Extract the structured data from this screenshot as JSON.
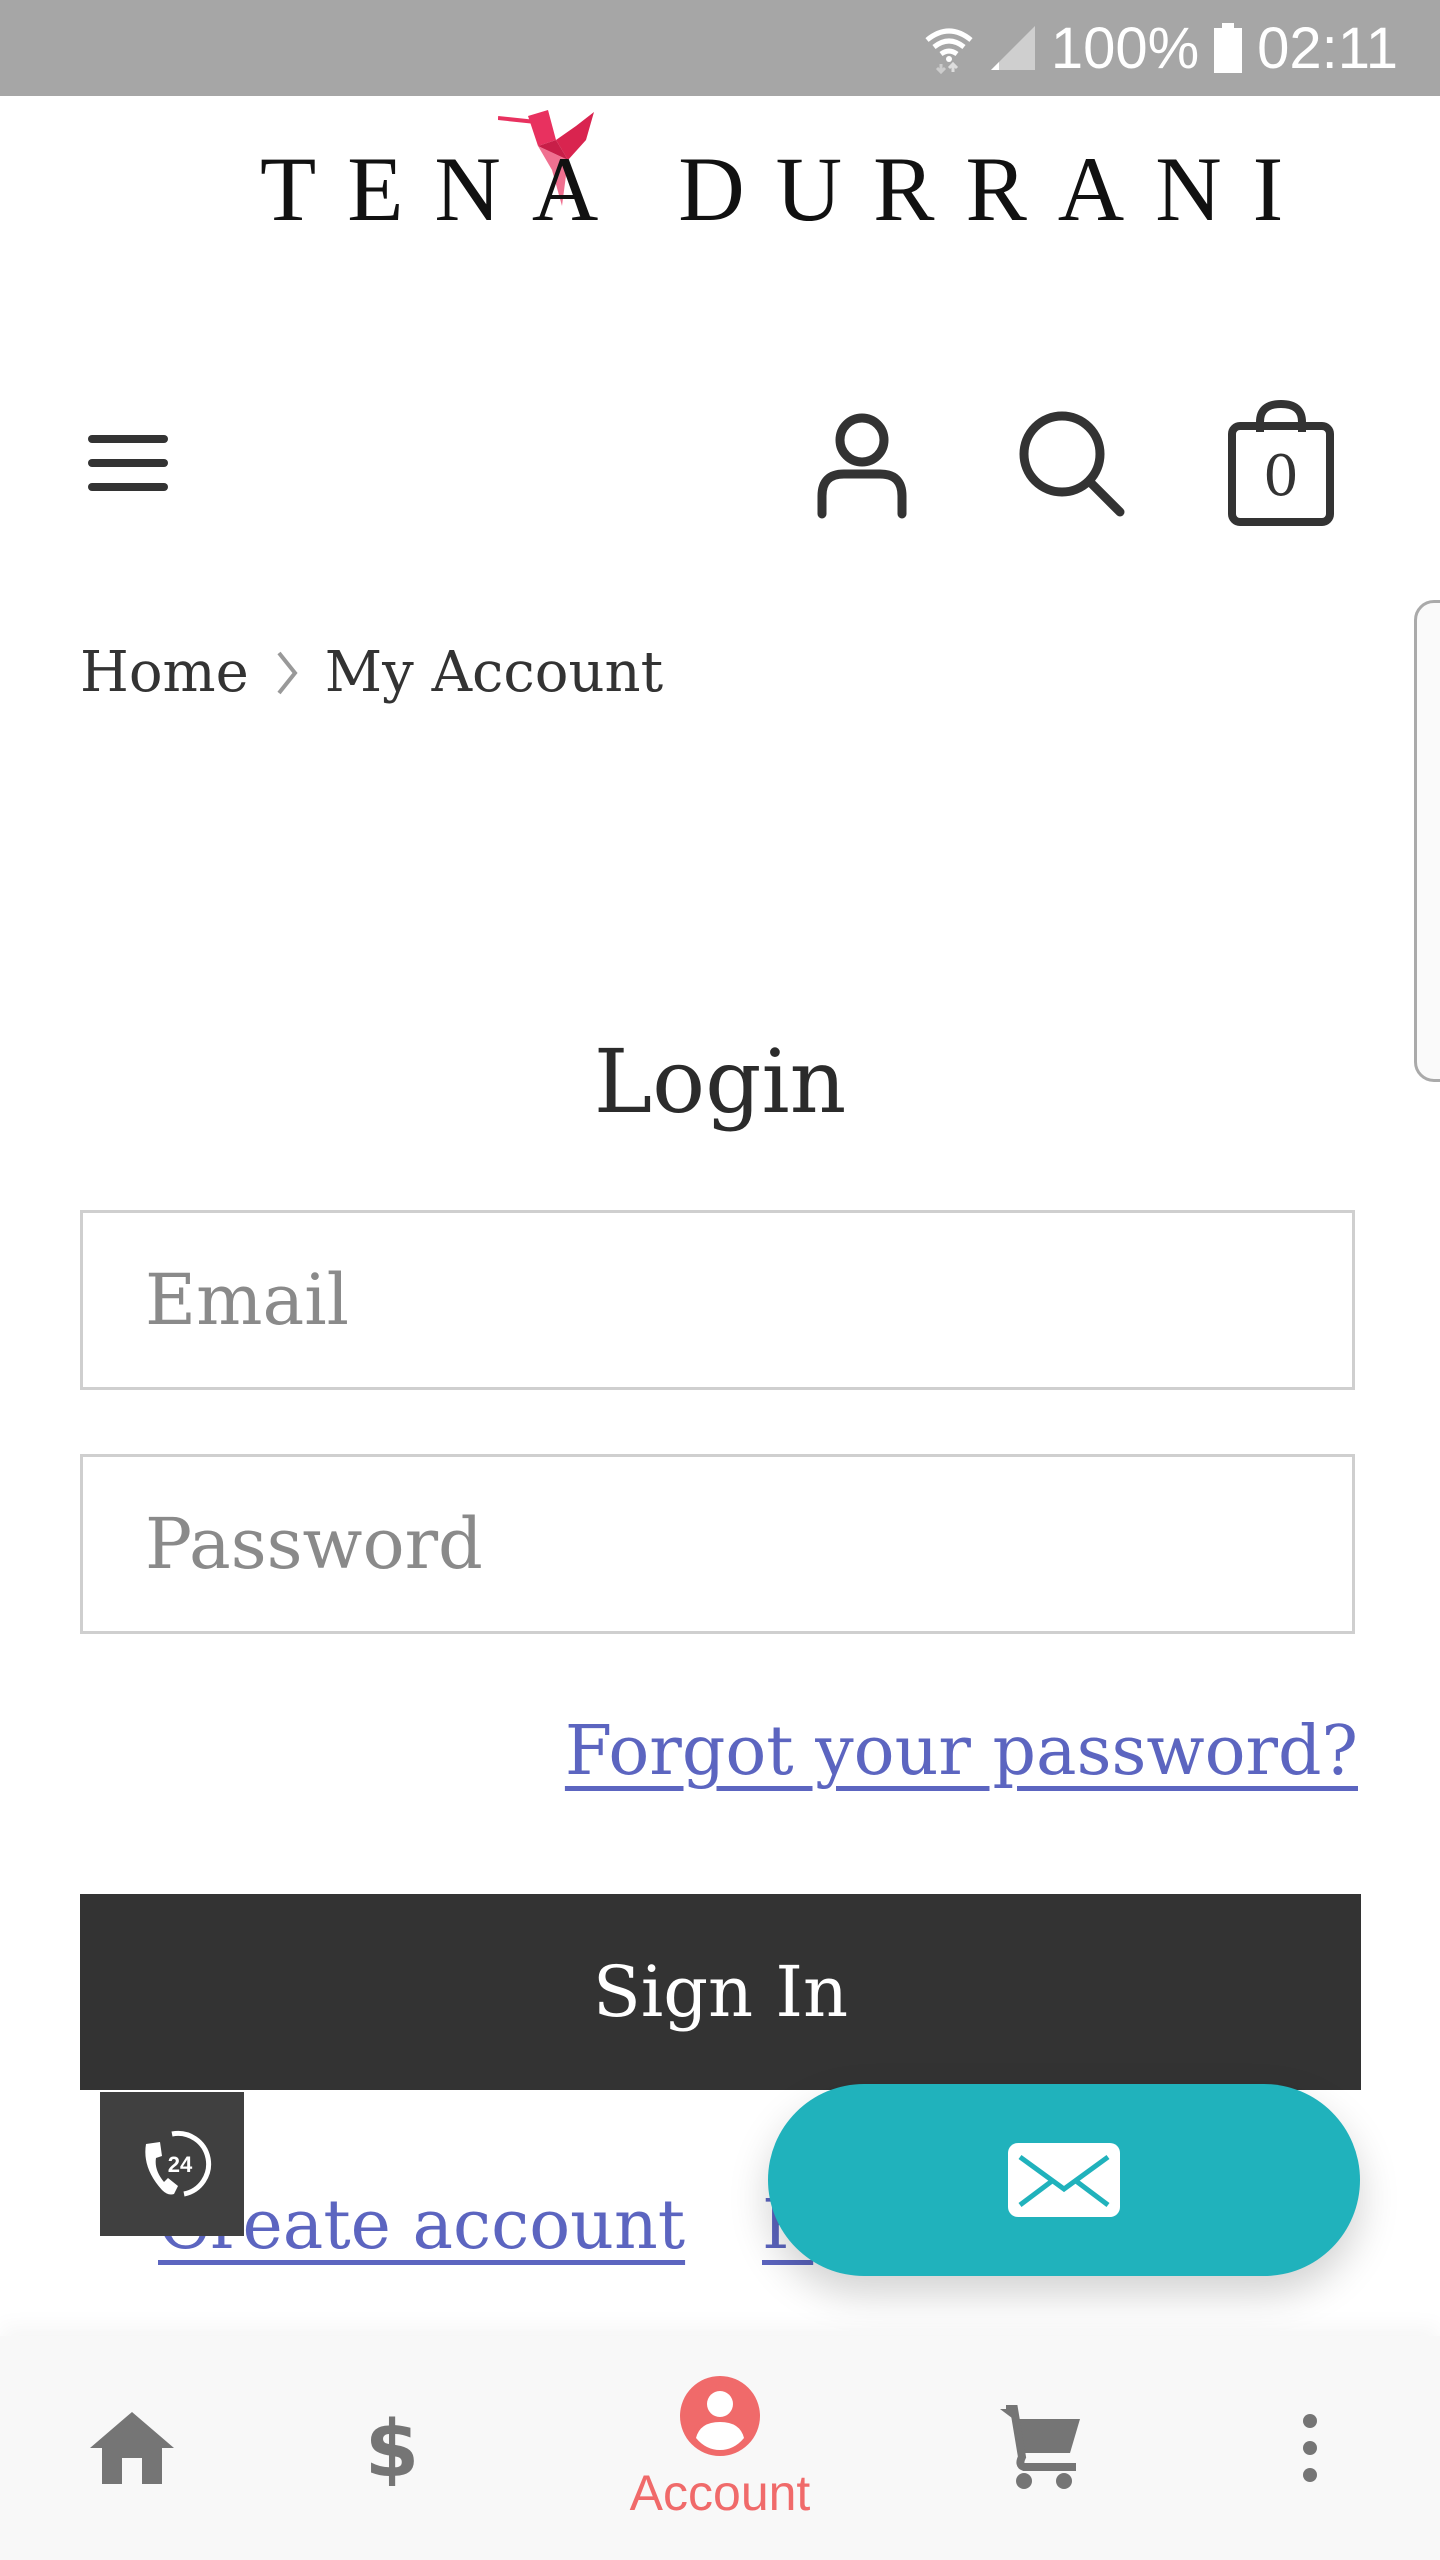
{
  "status_bar": {
    "battery": "100%",
    "time": "02:11",
    "icons": [
      "wifi-icon",
      "signal-icon",
      "battery-icon"
    ]
  },
  "brand": {
    "name": "TENA DURRANI",
    "accent": "#e8315f"
  },
  "header": {
    "icons": [
      "menu-icon",
      "account-icon",
      "search-icon",
      "cart-bag-icon"
    ],
    "cart_count": "0"
  },
  "breadcrumb": {
    "items": [
      {
        "label": "Home"
      },
      {
        "label": "My Account"
      }
    ],
    "separator_icon": "chevron-right-icon"
  },
  "login": {
    "title": "Login",
    "email_placeholder": "Email",
    "password_placeholder": "Password",
    "forgot_label": "Forgot your password?",
    "signin_label": "Sign In",
    "create_label": "Create account",
    "second_link_label": "R"
  },
  "floating": {
    "call_badge_text": "24",
    "call_icon": "phone-24-icon",
    "mail_icon": "mail-icon",
    "mail_color": "#20b2bc"
  },
  "bottom_nav": {
    "active_color": "#f06a6a",
    "inactive_color": "#757575",
    "items": [
      {
        "icon": "home-icon",
        "label": ""
      },
      {
        "icon": "dollar-icon",
        "label": ""
      },
      {
        "icon": "account-circle-icon",
        "label": "Account",
        "active": true
      },
      {
        "icon": "cart-icon",
        "label": ""
      },
      {
        "icon": "more-vertical-icon",
        "label": ""
      }
    ]
  },
  "colors": {
    "link": "#5c65c0",
    "button_dark": "#333333",
    "status_bar": "#a6a6a6"
  }
}
